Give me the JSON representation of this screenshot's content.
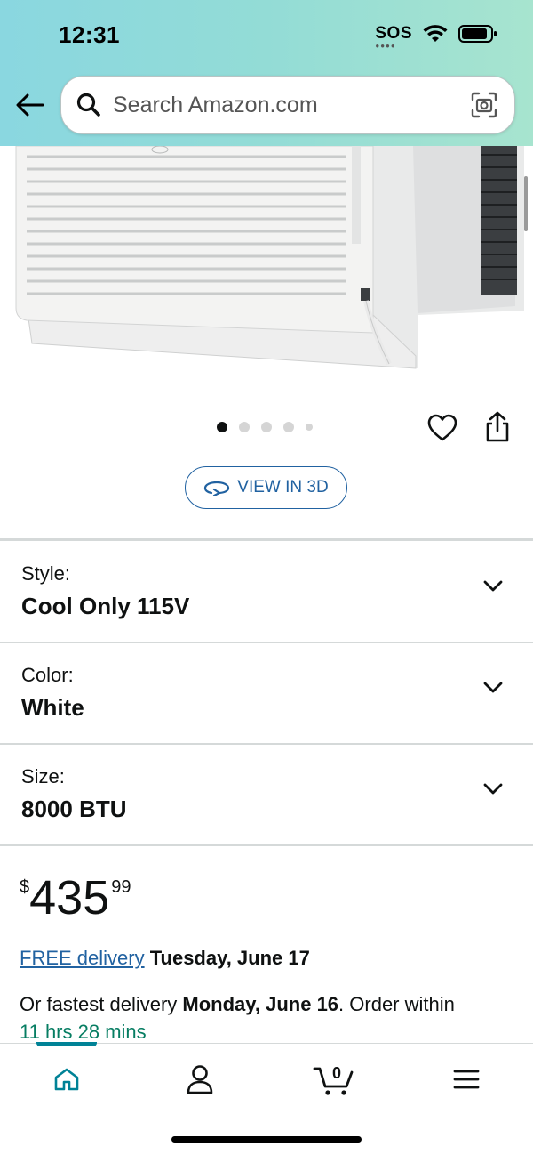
{
  "status_bar": {
    "time": "12:31",
    "sos": "SOS"
  },
  "search": {
    "placeholder": "Search Amazon.com"
  },
  "icons": {
    "back": "arrow-left-icon",
    "search": "search-icon",
    "camera": "camera-lens-icon",
    "heart": "heart-icon",
    "share": "share-icon",
    "view3d": "rotate-3d-icon",
    "home": "home-icon",
    "account": "person-icon",
    "cart": "cart-icon",
    "menu": "hamburger-menu-icon"
  },
  "carousel": {
    "total": 5,
    "active_index": 0
  },
  "view3d_label": "VIEW IN 3D",
  "options": [
    {
      "label": "Style:",
      "value": "Cool Only 115V"
    },
    {
      "label": "Color:",
      "value": "White"
    },
    {
      "label": "Size:",
      "value": "8000 BTU"
    }
  ],
  "price": {
    "symbol": "$",
    "whole": "435",
    "fraction": "99"
  },
  "delivery": {
    "link_text": "FREE delivery",
    "date": "Tuesday, June 17",
    "fastest_prefix": "Or fastest delivery",
    "fastest_date": "Monday, June 16",
    "fastest_suffix": ". Order within",
    "countdown": "11 hrs 28 mins"
  },
  "nav": {
    "cart_count": "0",
    "active": "home"
  },
  "colors": {
    "accent_teal": "#008296",
    "link_blue": "#2162a1",
    "countdown_green": "#067d62",
    "header_gradient": "#8ad7e0"
  }
}
